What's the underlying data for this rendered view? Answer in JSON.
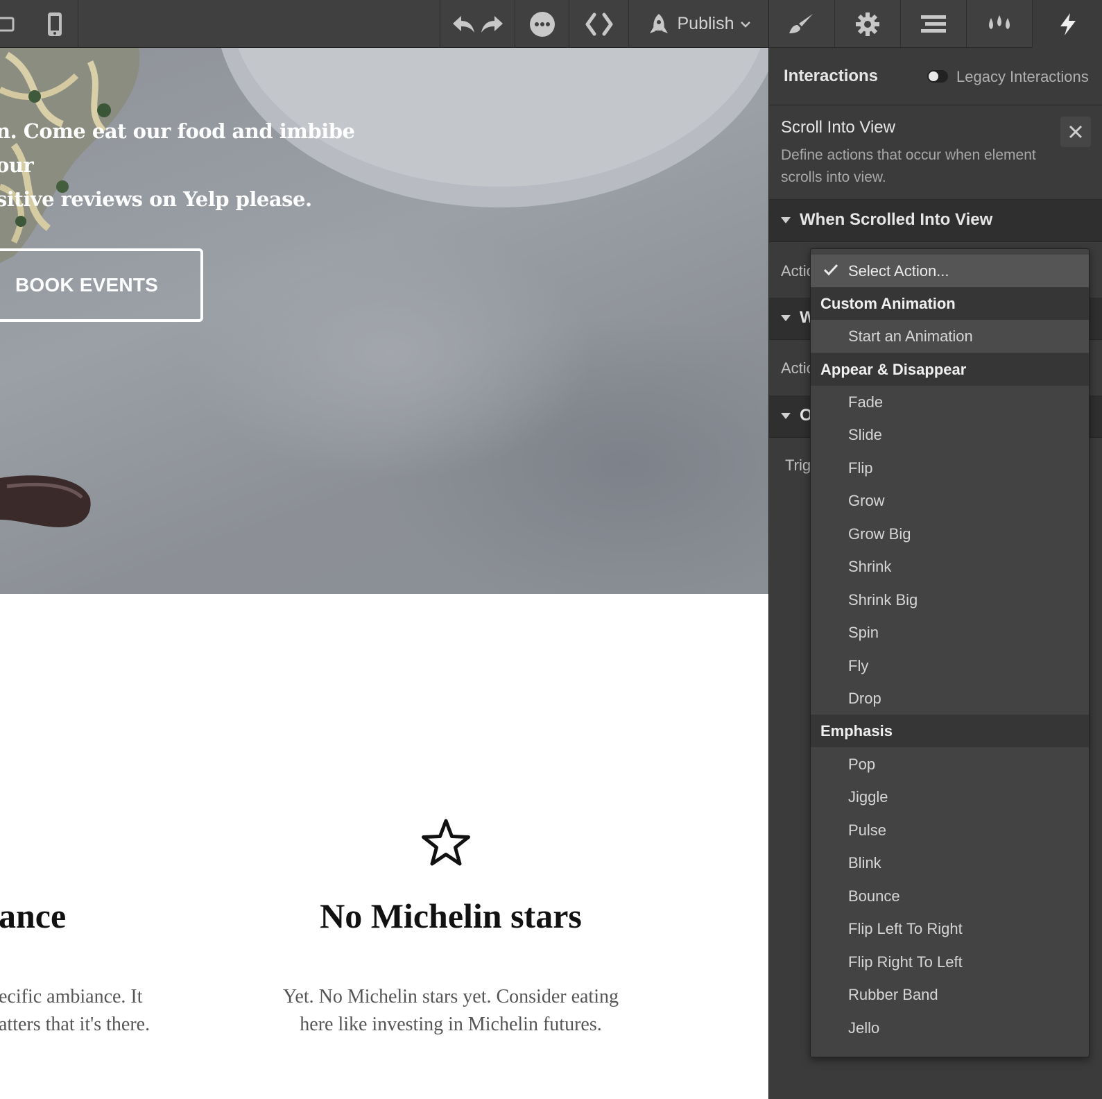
{
  "topbar": {
    "icons": [
      "desktop-icon",
      "mobile-icon",
      "undo-icon",
      "redo-icon",
      "more-icon",
      "code-icon",
      "publish-rocket-icon",
      "chevron-down-icon"
    ],
    "publish_label": "Publish"
  },
  "canvas": {
    "hero_text": "n. Come eat our food and imbibe our\nsitive reviews on Yelp please.",
    "book_button": "BOOK EVENTS",
    "left_title": "ance",
    "left_desc": "ecific ambiance. It\natters that it's there.",
    "feature_title": "No Michelin stars",
    "feature_desc": "Yet. No Michelin stars yet. Consider eating\nhere like investing in Michelin futures.",
    "feature_icon": "star-outline-icon"
  },
  "panel": {
    "tabs": [
      "brush-icon",
      "gear-icon",
      "navigator-icon",
      "drops-icon",
      "lightning-icon"
    ],
    "active_tab": "lightning-icon",
    "interactions_title": "Interactions",
    "legacy_label": "Legacy Interactions",
    "trigger_title": "Scroll Into View",
    "trigger_desc": "Define actions that occur when element scrolls into view.",
    "section1_title": "When Scrolled Into View",
    "section1_label": "Actio",
    "section2_title": "W",
    "section2_label": "Actio",
    "section3_title": "O",
    "section3_label": "Trig"
  },
  "dropdown": {
    "selected": "Select Action...",
    "groups": [
      {
        "title": "Custom Animation",
        "items": [
          "Start an Animation"
        ]
      },
      {
        "title": "Appear & Disappear",
        "items": [
          "Fade",
          "Slide",
          "Flip",
          "Grow",
          "Grow Big",
          "Shrink",
          "Shrink Big",
          "Spin",
          "Fly",
          "Drop"
        ]
      },
      {
        "title": "Emphasis",
        "items": [
          "Pop",
          "Jiggle",
          "Pulse",
          "Blink",
          "Bounce",
          "Flip Left To Right",
          "Flip Right To Left",
          "Rubber Band",
          "Jello"
        ]
      }
    ]
  }
}
